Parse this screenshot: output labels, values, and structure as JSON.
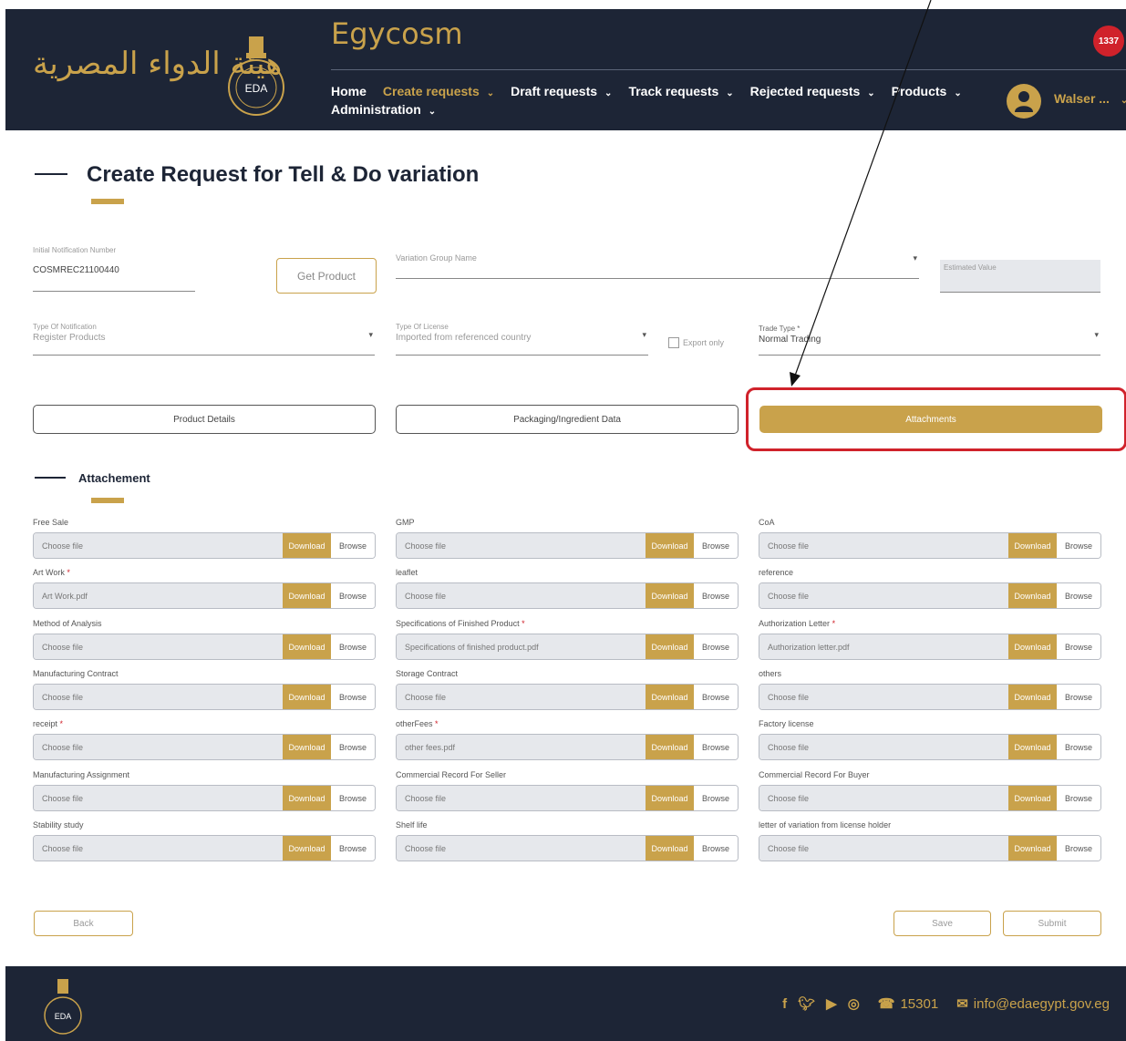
{
  "header": {
    "arabic_logo": "هيئة الدواء المصرية",
    "brand": "Egycosm",
    "nav_row1": [
      {
        "label": "Home",
        "caret": false,
        "active": false
      },
      {
        "label": "Create requests",
        "caret": true,
        "active": true
      },
      {
        "label": "Draft requests",
        "caret": true,
        "active": false
      },
      {
        "label": "Track requests",
        "caret": true,
        "active": false
      },
      {
        "label": "Rejected requests",
        "caret": true,
        "active": false
      },
      {
        "label": "Products",
        "caret": true,
        "active": false
      }
    ],
    "nav_row2": [
      {
        "label": "Administration",
        "caret": true,
        "active": false
      }
    ],
    "notification_count": "1337",
    "user_name": "Walser ...",
    "eda_logo_text": "EDA"
  },
  "page": {
    "title": "Create Request for Tell & Do variation"
  },
  "form": {
    "notification_label": "Initial Notification Number",
    "notification_value": "COSMREC21100440",
    "get_product": "Get Product",
    "variation_group_label": "Variation Group Name",
    "estimated_label": "Estimated Value",
    "type_of_notification_label": "Type Of Notification",
    "type_of_notification_value": "Register Products",
    "type_of_license_label": "Type Of License",
    "type_of_license_value": "Imported from referenced country",
    "export_only": "Export only",
    "trade_type_label": "Trade Type *",
    "trade_type_value": "Normal Trading"
  },
  "tabs": {
    "product_details": "Product Details",
    "packaging": "Packaging/Ingredient Data",
    "attachments": "Attachments"
  },
  "attachments_section": {
    "title": "Attachement",
    "download_label": "Download",
    "browse_label": "Browse",
    "columns": [
      [
        {
          "label": "Free Sale",
          "required": false,
          "file": "Choose file"
        },
        {
          "label": "Art Work",
          "required": true,
          "file": "Art Work.pdf"
        },
        {
          "label": "Method of Analysis",
          "required": false,
          "file": "Choose file"
        },
        {
          "label": "Manufacturing Contract",
          "required": false,
          "file": "Choose file"
        },
        {
          "label": "receipt",
          "required": true,
          "file": "Choose file"
        },
        {
          "label": "Manufacturing Assignment",
          "required": false,
          "file": "Choose file"
        },
        {
          "label": "Stability study",
          "required": false,
          "file": "Choose file"
        }
      ],
      [
        {
          "label": "GMP",
          "required": false,
          "file": "Choose file"
        },
        {
          "label": "leaflet",
          "required": false,
          "file": "Choose file"
        },
        {
          "label": "Specifications of Finished Product",
          "required": true,
          "file": "Specifications of finished product.pdf"
        },
        {
          "label": "Storage Contract",
          "required": false,
          "file": "Choose file"
        },
        {
          "label": "otherFees",
          "required": true,
          "file": "other fees.pdf"
        },
        {
          "label": "Commercial Record For Seller",
          "required": false,
          "file": "Choose file"
        },
        {
          "label": "Shelf life",
          "required": false,
          "file": "Choose file"
        }
      ],
      [
        {
          "label": "CoA",
          "required": false,
          "file": "Choose file"
        },
        {
          "label": "reference",
          "required": false,
          "file": "Choose file"
        },
        {
          "label": "Authorization Letter",
          "required": true,
          "file": "Authorization letter.pdf"
        },
        {
          "label": "others",
          "required": false,
          "file": "Choose file"
        },
        {
          "label": "Factory license",
          "required": false,
          "file": "Choose file"
        },
        {
          "label": "Commercial Record For Buyer",
          "required": false,
          "file": "Choose file"
        },
        {
          "label": "letter of variation from license holder",
          "required": false,
          "file": "Choose file"
        }
      ]
    ]
  },
  "actions": {
    "back": "Back",
    "save": "Save",
    "submit": "Submit"
  },
  "footer": {
    "phone": "15301",
    "email": "info@edaegypt.gov.eg",
    "social_icons": [
      "facebook-icon",
      "twitter-icon",
      "youtube-icon",
      "instagram-icon"
    ]
  },
  "colors": {
    "navy": "#1d2536",
    "gold": "#c9a24b",
    "red": "#d0222b"
  }
}
